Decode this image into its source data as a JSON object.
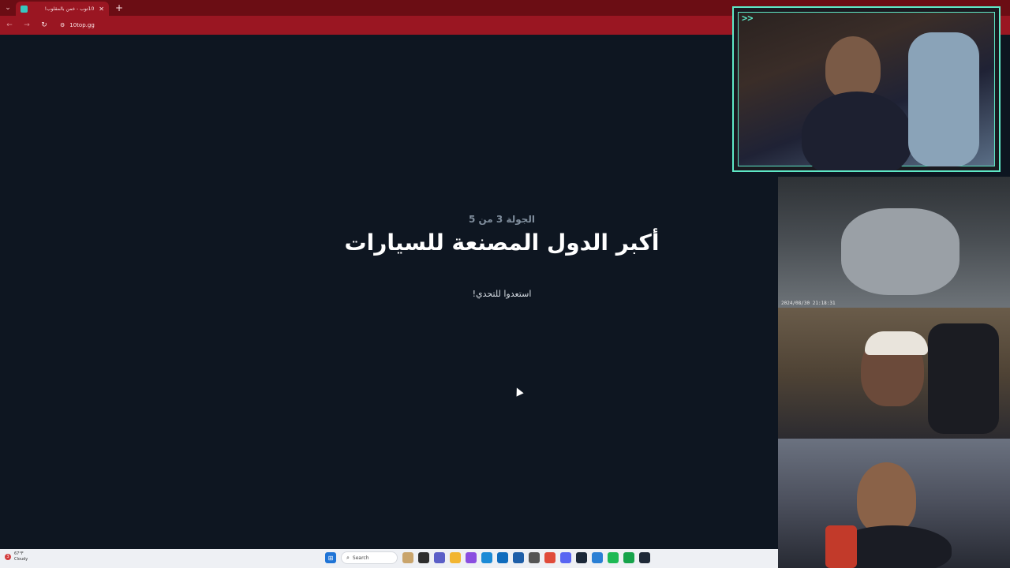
{
  "browser": {
    "tab_title": "10توب - خمن بالمقلوب!",
    "new_tab": "+",
    "close": "✕",
    "url": "10top.gg"
  },
  "game": {
    "round": "الجولة 3 من 5",
    "headline": "أكبر الدول المصنعة للسيارات",
    "subtitle": "استعدوا للتحدي!"
  },
  "taskbar": {
    "weather_badge": "3",
    "temp": "67°F",
    "condition": "Cloudy",
    "search_label": "Search"
  },
  "cams": {
    "cam1_overlay": ">>",
    "cam2_timestamp": "2024/08/30 21:18:31"
  }
}
